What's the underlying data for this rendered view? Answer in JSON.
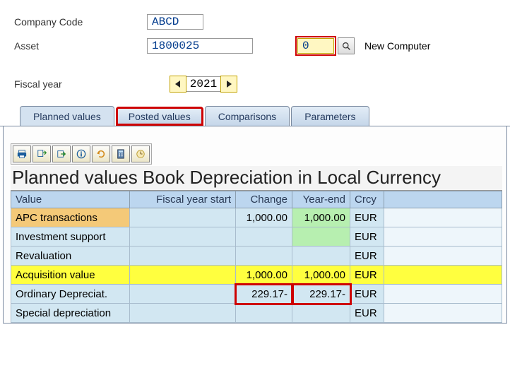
{
  "form": {
    "company_code_label": "Company Code",
    "company_code_value": "ABCD",
    "asset_label": "Asset",
    "asset_value": "1800025",
    "asset_sub_value": "0",
    "asset_desc": "New Computer",
    "fiscal_year_label": "Fiscal year",
    "fiscal_year_value": "2021"
  },
  "tabs": {
    "t0": "Planned values",
    "t1": "Posted values",
    "t2": "Comparisons",
    "t3": "Parameters"
  },
  "grid_title": "Planned values Book Depreciation in Local Currency",
  "headers": {
    "value": "Value",
    "fys": "Fiscal year start",
    "change": "Change",
    "yearend": "Year-end",
    "crcy": "Crcy"
  },
  "rows": {
    "apc": {
      "label": "APC transactions",
      "fys": "",
      "change": "1,000.00",
      "yearend": "1,000.00",
      "crcy": "EUR"
    },
    "inv": {
      "label": "Investment support",
      "fys": "",
      "change": "",
      "yearend": "",
      "crcy": "EUR"
    },
    "rev": {
      "label": "Revaluation",
      "fys": "",
      "change": "",
      "yearend": "",
      "crcy": "EUR"
    },
    "acq": {
      "label": "Acquisition value",
      "fys": "",
      "change": "1,000.00",
      "yearend": "1,000.00",
      "crcy": "EUR"
    },
    "ord": {
      "label": "Ordinary Depreciat.",
      "fys": "",
      "change": "229.17-",
      "yearend": "229.17-",
      "crcy": "EUR"
    },
    "spec": {
      "label": "Special depreciation",
      "fys": "",
      "change": "",
      "yearend": "",
      "crcy": "EUR"
    }
  }
}
